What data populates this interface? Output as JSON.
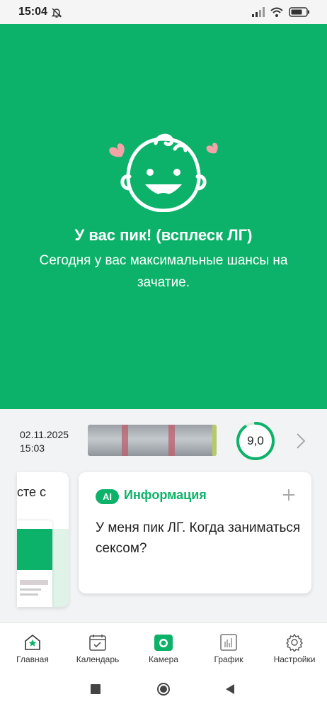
{
  "status_bar": {
    "time": "15:04",
    "icons": [
      "bell-off-icon",
      "signal-icon",
      "wifi-icon",
      "battery-icon"
    ]
  },
  "hero": {
    "icon": "happy-baby-face-icon",
    "title": "У вас пик! (всплеск ЛГ)",
    "subtitle": "Сегодня у вас максимальные шансы на зачатие.",
    "background_color": "#0db26a"
  },
  "test_result": {
    "date": "02.11.2025",
    "time": "15:03",
    "score": "9,0",
    "score_fraction": 0.9
  },
  "cards": {
    "previous_card_text": "сте с",
    "info": {
      "badge": "AI",
      "title": "Информация",
      "body": "У меня пик ЛГ. Когда заниматься сексом?"
    }
  },
  "bottom_nav": [
    {
      "label": "Главная",
      "icon": "home-star-icon"
    },
    {
      "label": "Календарь",
      "icon": "calendar-icon"
    },
    {
      "label": "Камера",
      "icon": "camera-icon"
    },
    {
      "label": "График",
      "icon": "chart-icon"
    },
    {
      "label": "Настройки",
      "icon": "gear-icon"
    }
  ],
  "colors": {
    "accent": "#0db26a",
    "heart": "#f4a3a8"
  }
}
